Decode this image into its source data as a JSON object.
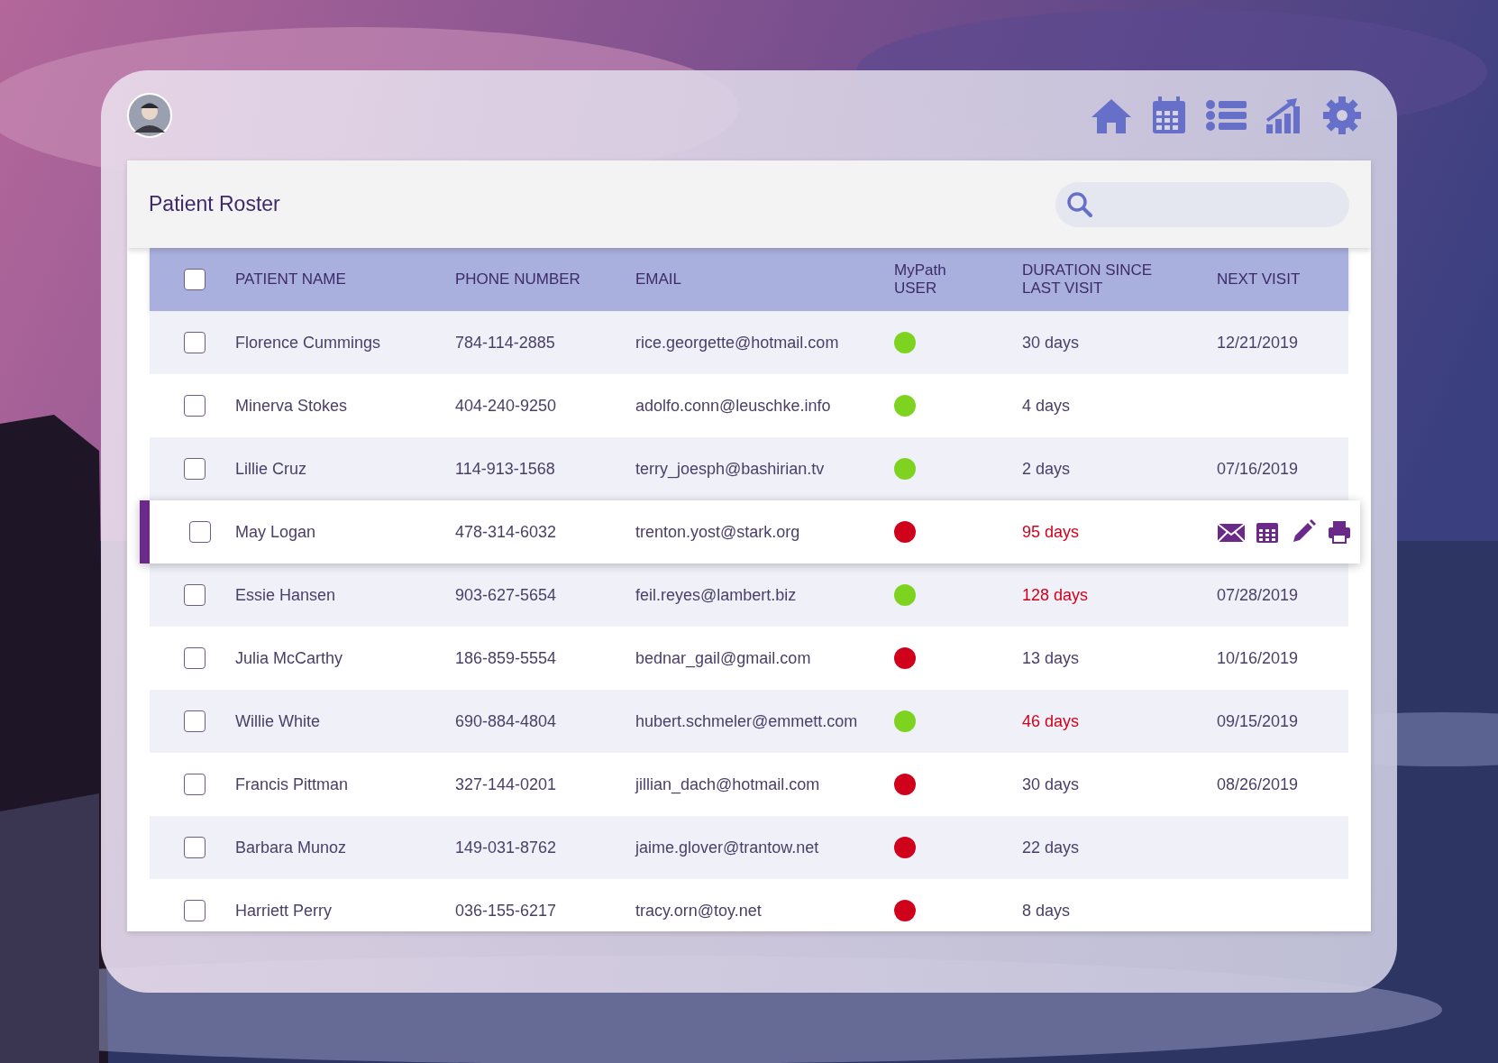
{
  "header": {
    "nav": [
      {
        "kind": "home"
      },
      {
        "kind": "calendar"
      },
      {
        "kind": "list"
      },
      {
        "kind": "chart"
      },
      {
        "kind": "settings"
      }
    ]
  },
  "panel": {
    "title": "Patient Roster"
  },
  "table": {
    "columns": [
      "PATIENT NAME",
      "PHONE NUMBER",
      "EMAIL",
      "MyPath USER",
      "DURATION SINCE LAST VISIT",
      "NEXT VISIT"
    ],
    "select_all": {
      "checked": false
    },
    "rows": [
      {
        "name": "Florence Cummings",
        "phone": "784-114-2885",
        "email": "rice.georgette@hotmail.com",
        "mypath_user": true,
        "duration": "30 days",
        "overdue": false,
        "next_visit": "12/21/2019",
        "checked": false,
        "selected": false
      },
      {
        "name": "Minerva Stokes",
        "phone": "404-240-9250",
        "email": "adolfo.conn@leuschke.info",
        "mypath_user": true,
        "duration": "4 days",
        "overdue": false,
        "checked": false,
        "selected": false
      },
      {
        "name": "Lillie Cruz",
        "phone": "114-913-1568",
        "email": "terry_joesph@bashirian.tv",
        "mypath_user": true,
        "duration": "2 days",
        "overdue": false,
        "next_visit": "07/16/2019",
        "checked": false,
        "selected": false
      },
      {
        "name": "May Logan",
        "phone": "478-314-6032",
        "email": "trenton.yost@stark.org",
        "mypath_user": false,
        "duration": "95 days",
        "overdue": true,
        "checked": false,
        "selected": true
      },
      {
        "name": "Essie Hansen",
        "phone": "903-627-5654",
        "email": "feil.reyes@lambert.biz",
        "mypath_user": true,
        "duration": "128 days",
        "overdue": true,
        "next_visit": "07/28/2019",
        "checked": false,
        "selected": false
      },
      {
        "name": "Julia McCarthy",
        "phone": "186-859-5554",
        "email": "bednar_gail@gmail.com",
        "mypath_user": false,
        "duration": "13 days",
        "overdue": false,
        "next_visit": "10/16/2019",
        "checked": false,
        "selected": false
      },
      {
        "name": "Willie White",
        "phone": "690-884-4804",
        "email": "hubert.schmeler@emmett.com",
        "mypath_user": true,
        "duration": "46 days",
        "overdue": true,
        "next_visit": "09/15/2019",
        "checked": false,
        "selected": false
      },
      {
        "name": "Francis Pittman",
        "phone": "327-144-0201",
        "email": "jillian_dach@hotmail.com",
        "mypath_user": false,
        "duration": "30 days",
        "overdue": false,
        "next_visit": "08/26/2019",
        "checked": false,
        "selected": false
      },
      {
        "name": "Barbara Munoz",
        "phone": "149-031-8762",
        "email": "jaime.glover@trantow.net",
        "mypath_user": false,
        "duration": "22 days",
        "overdue": false,
        "checked": false,
        "selected": false
      },
      {
        "name": "Harriett Perry",
        "phone": "036-155-6217",
        "email": "tracy.orn@toy.net",
        "mypath_user": false,
        "duration": "8 days",
        "overdue": false,
        "checked": false,
        "selected": false
      }
    ]
  }
}
